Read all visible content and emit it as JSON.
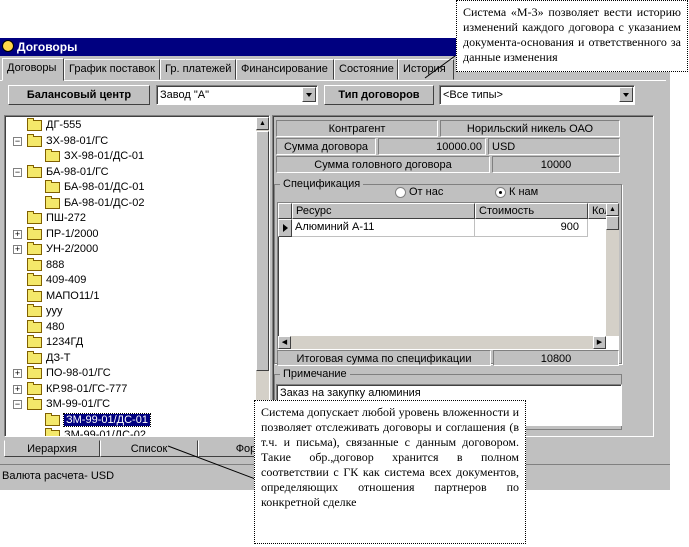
{
  "window": {
    "title": "Договоры"
  },
  "tabs": [
    "Договоры",
    "График поставок",
    "Гр. платежей",
    "Финансирование",
    "Состояние",
    "История"
  ],
  "filters": {
    "balance_center_label": "Балансовый центр",
    "balance_center_value": "Завод \"А\"",
    "contract_type_label": "Тип договоров",
    "contract_type_value": "<Все типы>"
  },
  "tree": [
    {
      "label": "ДГ-555",
      "level": 1,
      "expander": ""
    },
    {
      "label": "ЗХ-98-01/ГС",
      "level": 1,
      "expander": "−"
    },
    {
      "label": "ЗХ-98-01/ДС-01",
      "level": 2,
      "expander": ""
    },
    {
      "label": "БА-98-01/ГС",
      "level": 1,
      "expander": "−"
    },
    {
      "label": "БА-98-01/ДС-01",
      "level": 2,
      "expander": ""
    },
    {
      "label": "БА-98-01/ДС-02",
      "level": 2,
      "expander": ""
    },
    {
      "label": "ПШ-272",
      "level": 1,
      "expander": ""
    },
    {
      "label": "ПР-1/2000",
      "level": 1,
      "expander": "+"
    },
    {
      "label": "УН-2/2000",
      "level": 1,
      "expander": "+"
    },
    {
      "label": "888",
      "level": 1,
      "expander": ""
    },
    {
      "label": "409-409",
      "level": 1,
      "expander": ""
    },
    {
      "label": "МАПО11/1",
      "level": 1,
      "expander": ""
    },
    {
      "label": "ууу",
      "level": 1,
      "expander": ""
    },
    {
      "label": "480",
      "level": 1,
      "expander": ""
    },
    {
      "label": "1234ГД",
      "level": 1,
      "expander": ""
    },
    {
      "label": "ДЗ-Т",
      "level": 1,
      "expander": ""
    },
    {
      "label": "ПО-98-01/ГС",
      "level": 1,
      "expander": "+"
    },
    {
      "label": "КР.98-01/ГС-777",
      "level": 1,
      "expander": "+"
    },
    {
      "label": "ЗМ-99-01/ГС",
      "level": 1,
      "expander": "−"
    },
    {
      "label": "ЗМ-99-01/ДС-01",
      "level": 2,
      "expander": "",
      "selected": true
    },
    {
      "label": "ЗМ-99-01/ДС-02",
      "level": 2,
      "expander": ""
    }
  ],
  "details": {
    "counterparty_label": "Контрагент",
    "counterparty_value": "Норильский никель ОАО",
    "contract_sum_label": "Сумма договора",
    "contract_sum_value": "10000.00",
    "currency": "USD",
    "head_sum_label": "Сумма головного договора",
    "head_sum_value": "10000"
  },
  "spec": {
    "group_label": "Спецификация",
    "radio_from_us": "От нас",
    "radio_to_us": "К нам",
    "columns": [
      "Ресурс",
      "Стоимость",
      "Кол"
    ],
    "rows": [
      {
        "resource": "Алюминий А-11",
        "cost": "900"
      }
    ],
    "total_label": "Итоговая сумма по спецификации",
    "total_value": "10800"
  },
  "note": {
    "label": "Примечание",
    "text": "Заказ на закупку алюминия"
  },
  "bottom_tabs": [
    "Иерархия",
    "Список",
    "Фор"
  ],
  "status": "Валюта расчета- USD",
  "callouts": {
    "top": "Система «М-3» позволяет вести историю изменений каждого договора с указанием документа-основания и ответственного за данные изменения",
    "bottom": "Система допускает любой уровень вложенности и позволяет отслеживать договоры и соглашения (в т.ч. и письма), связанные с данным договором. Такие обр.,договор хранится в полном соответствии с ГК как система всех документов, определяющих отношения партнеров по конкретной сделке"
  }
}
